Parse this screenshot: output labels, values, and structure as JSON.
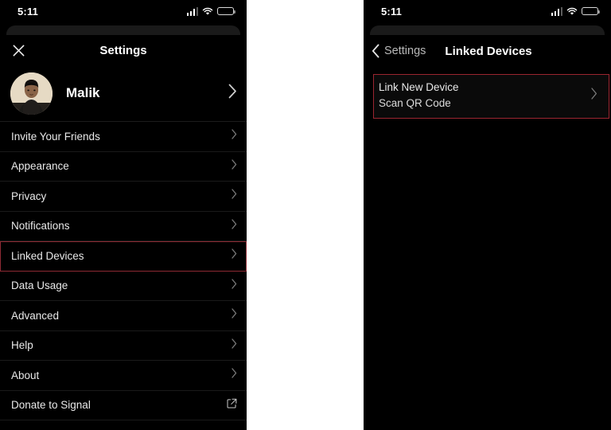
{
  "status_bar": {
    "time": "5:11",
    "cellular_icon": "signal-bars-icon",
    "wifi_icon": "wifi-icon",
    "battery_icon": "battery-icon"
  },
  "colors": {
    "background": "#000000",
    "gap": "#ffffff",
    "highlight_border": "#9b2530",
    "text_primary": "#e9e9e9",
    "text_secondary": "#b9b9b9",
    "chevron": "#7b7b7b"
  },
  "left_panel": {
    "close_icon": "close-icon",
    "title": "Settings",
    "profile": {
      "avatar_icon": "avatar",
      "name": "Malik",
      "chevron_icon": "chevron-right-icon"
    },
    "items": [
      {
        "label": "Invite Your Friends",
        "accessory": "chevron-right-icon",
        "highlighted": false
      },
      {
        "label": "Appearance",
        "accessory": "chevron-right-icon",
        "highlighted": false
      },
      {
        "label": "Privacy",
        "accessory": "chevron-right-icon",
        "highlighted": false
      },
      {
        "label": "Notifications",
        "accessory": "chevron-right-icon",
        "highlighted": false
      },
      {
        "label": "Linked Devices",
        "accessory": "chevron-right-icon",
        "highlighted": true
      },
      {
        "label": "Data Usage",
        "accessory": "chevron-right-icon",
        "highlighted": false
      },
      {
        "label": "Advanced",
        "accessory": "chevron-right-icon",
        "highlighted": false
      },
      {
        "label": "Help",
        "accessory": "chevron-right-icon",
        "highlighted": false
      },
      {
        "label": "About",
        "accessory": "chevron-right-icon",
        "highlighted": false
      },
      {
        "label": "Donate to Signal",
        "accessory": "external-link-icon",
        "highlighted": false
      }
    ]
  },
  "right_panel": {
    "back_icon": "chevron-left-icon",
    "back_label": "Settings",
    "title": "Linked Devices",
    "link_card": {
      "title": "Link New Device",
      "subtitle": "Scan QR Code",
      "chevron_icon": "chevron-right-icon",
      "highlighted": true
    }
  }
}
